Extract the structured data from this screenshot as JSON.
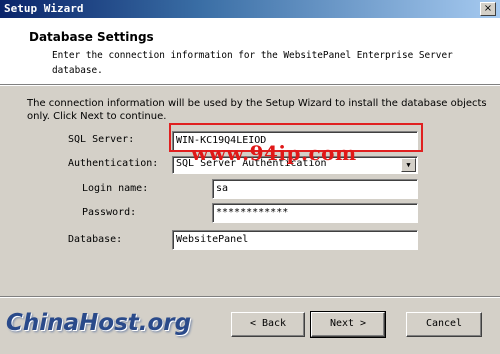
{
  "window": {
    "title": "Setup Wizard",
    "close_glyph": "×"
  },
  "header": {
    "title": "Database Settings",
    "description": "Enter the connection information for the WebsitePanel Enterprise Server database."
  },
  "info_text": "The connection information will be used by the Setup Wizard to install the database objects only. Click Next to continue.",
  "form": {
    "sql_server_label": "SQL Server:",
    "sql_server_value": "WIN-KC19Q4LEIOD",
    "authentication_label": "Authentication:",
    "authentication_value": "SQL Server Authentication",
    "login_label": "Login name:",
    "login_value": "sa",
    "password_label": "Password:",
    "password_value": "************",
    "database_label": "Database:",
    "database_value": "WebsitePanel"
  },
  "buttons": {
    "back": "< Back",
    "next": "Next >",
    "cancel": "Cancel"
  },
  "watermark": "www.94ip.com",
  "logo": "ChinaHost.org",
  "colors": {
    "titlebar": "#0a246a",
    "highlight": "#e02020",
    "watermark": "#e01818"
  }
}
